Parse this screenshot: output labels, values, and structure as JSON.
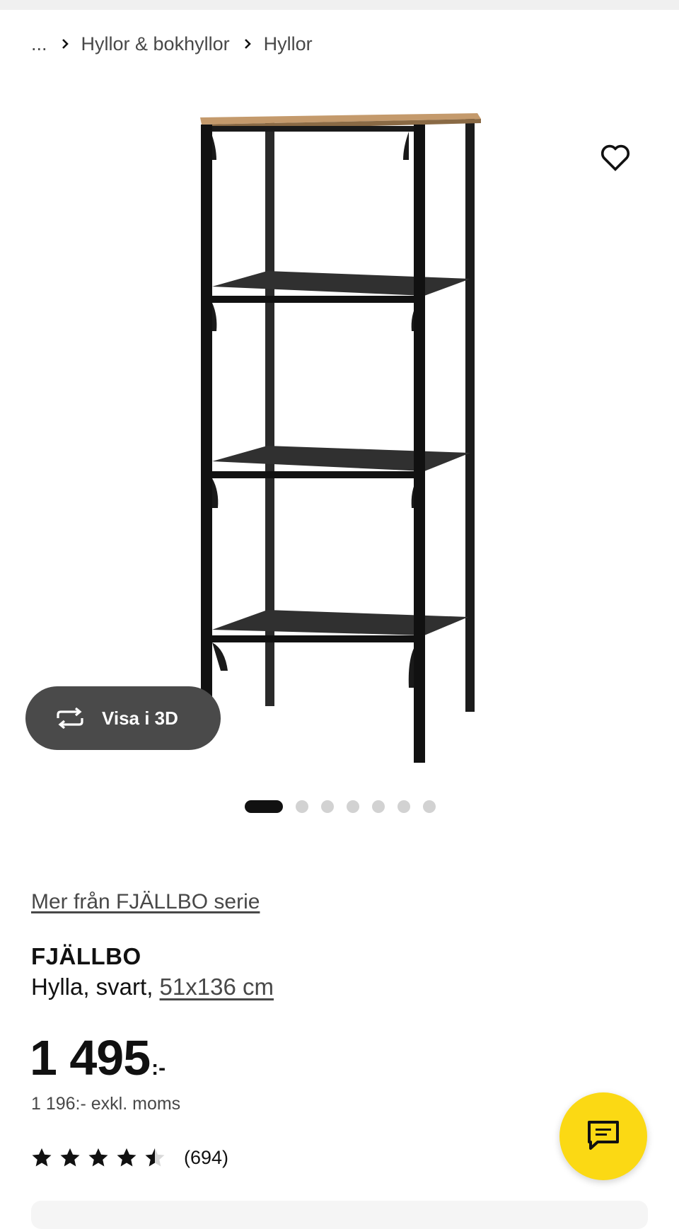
{
  "breadcrumb": {
    "ellipsis": "...",
    "items": [
      "Hyllor & bokhyllor",
      "Hyllor"
    ]
  },
  "gallery": {
    "view_3d_label": "Visa i 3D",
    "slide_count": 7,
    "active_slide": 1
  },
  "product": {
    "series_link": "Mer från FJÄLLBO serie",
    "name": "FJÄLLBO",
    "desc_prefix": "Hylla, svart,",
    "dimensions": "51x136 cm",
    "price": "1 495",
    "price_suffix": ":-",
    "price_ex_vat": "1 196:- exkl. moms",
    "rating": 4.5,
    "review_count": "(694)"
  },
  "icons": {
    "favorite": "heart-icon",
    "view_3d": "rotate-3d-icon",
    "chat": "chat-icon",
    "separator": "chevron-right-icon"
  },
  "colors": {
    "chat_button": "#fbd914",
    "view_3d_button": "#4a4a4a",
    "text": "#111111",
    "muted_text": "#484848"
  }
}
